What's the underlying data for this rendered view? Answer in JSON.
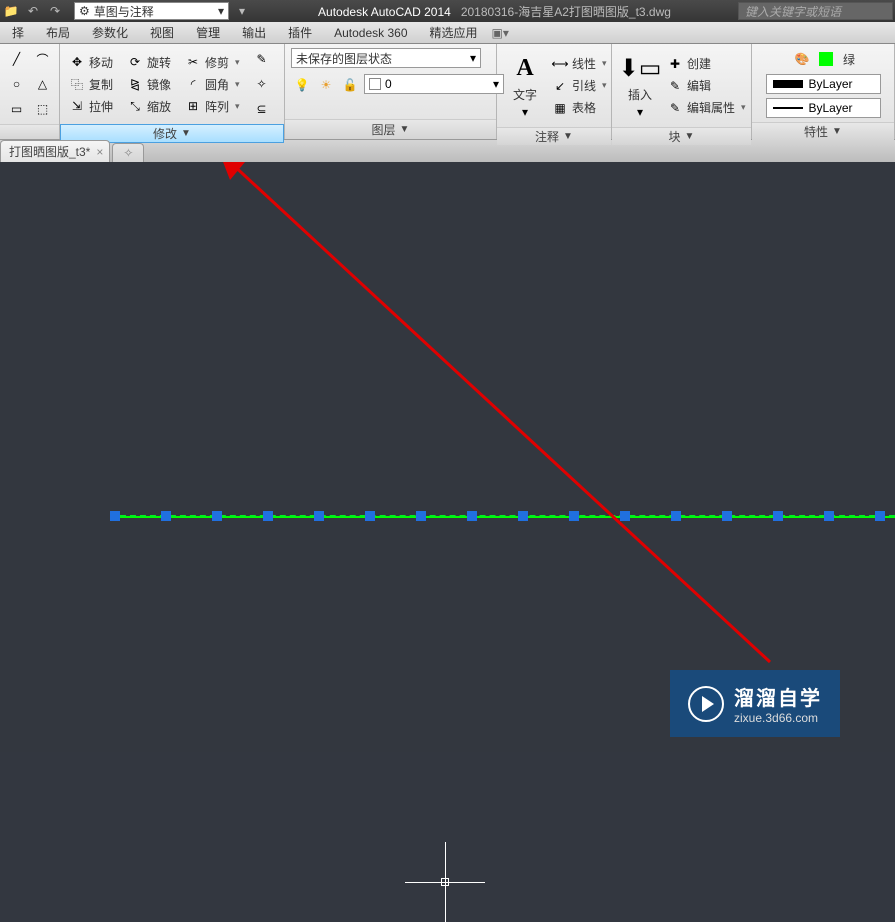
{
  "title": {
    "app": "Autodesk AutoCAD 2014",
    "file": "20180316-海吉星A2打图晒图版_t3.dwg"
  },
  "search_placeholder": "键入关键字或短语",
  "qat_dropdown": "草图与注释",
  "menus": [
    "择",
    "布局",
    "参数化",
    "视图",
    "管理",
    "输出",
    "插件",
    "Autodesk 360",
    "精选应用"
  ],
  "ribbon": {
    "modify": {
      "title": "修改",
      "items": {
        "move": "移动",
        "rotate": "旋转",
        "trim": "修剪",
        "copy": "复制",
        "mirror": "镜像",
        "fillet": "圆角",
        "stretch": "拉伸",
        "scale": "缩放",
        "array": "阵列"
      }
    },
    "layer": {
      "title": "图层",
      "state": "未保存的图层状态",
      "current_layer": "0"
    },
    "annot": {
      "title": "注释",
      "text": "文字",
      "linear": "线性",
      "leader": "引线",
      "table": "表格"
    },
    "block": {
      "title": "块",
      "insert": "插入",
      "create": "创建",
      "edit": "编辑",
      "editattr": "编辑属性"
    },
    "props": {
      "title": "特性",
      "color": "绿",
      "bylayer": "ByLayer"
    }
  },
  "filetab": {
    "name": "打图晒图版_t3*"
  },
  "watermark": {
    "line1": "溜溜自学",
    "line2": "zixue.3d66.com"
  }
}
